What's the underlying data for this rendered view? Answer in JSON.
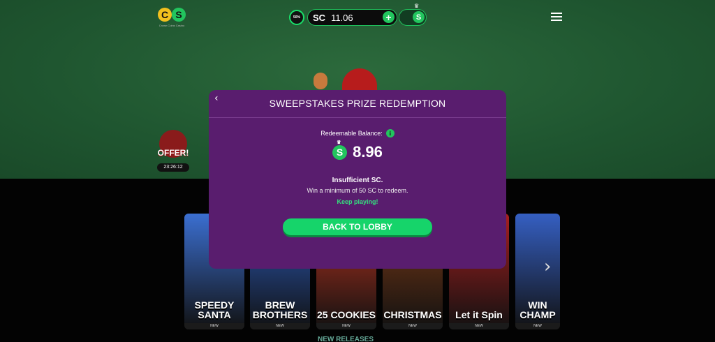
{
  "header": {
    "logo_letters": [
      "C",
      "S"
    ],
    "logo_tagline": "Crown Coins Casino",
    "promo_badge": "50%",
    "currency": "SC",
    "balance": "11.06",
    "add_icon": "plus-icon",
    "switch_symbol": "S",
    "menu_icon": "hamburger-icon"
  },
  "offer": {
    "label": "OFFER!",
    "timer": "23:26:12"
  },
  "games": [
    {
      "title": "SPEEDY SANTA",
      "badge": "NEW",
      "color": "#3b6fd1"
    },
    {
      "title": "BREW BROTHERS",
      "badge": "NEW",
      "color": "#2b5ab8"
    },
    {
      "title": "25 COOKIES",
      "badge": "NEW",
      "color": "#b8331f"
    },
    {
      "title": "CHRISTMAS",
      "badge": "NEW",
      "color": "#7c3a16"
    },
    {
      "title": "Let it Spin",
      "badge": "NEW",
      "color": "#a81f1f"
    },
    {
      "title": "WIN CHAMP",
      "badge": "NEW",
      "color": "#355fc2"
    }
  ],
  "section_title": "NEW RELEASES",
  "modal": {
    "back_icon": "chevron-left-icon",
    "title": "SWEEPSTAKES PRIZE REDEMPTION",
    "redeemable_label": "Redeemable Balance:",
    "info_icon": "info-icon",
    "coin_symbol": "S",
    "amount": "8.96",
    "insufficient": "Insufficient SC.",
    "minimum_text": "Win a minimum of 50 SC to redeem.",
    "keep_playing": "Keep playing!",
    "back_button": "BACK TO LOBBY"
  },
  "colors": {
    "accent_green": "#22c55e",
    "modal_bg": "#591d6e",
    "bg_green": "#1f5630"
  }
}
